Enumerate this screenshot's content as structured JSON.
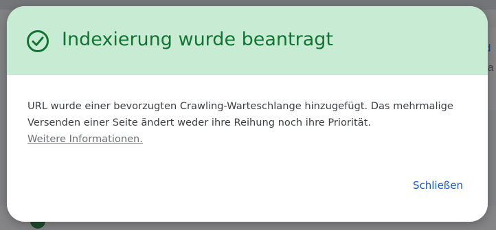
{
  "background": {
    "right_text_1": "d",
    "right_text_2": "a"
  },
  "dialog": {
    "icon": "check-circle-icon",
    "title": "Indexierung wurde beantragt",
    "message": "URL wurde einer bevorzugten Crawling-Warteschlange hinzugefügt. Das mehrmalige Versenden einer Seite ändert weder ihre Reihung noch ihre Priorität.",
    "link_text": "Weitere Informationen.",
    "close_label": "Schließen"
  },
  "colors": {
    "header_bg": "#c8ecd3",
    "title": "#137333",
    "accent_link": "#1a57c8"
  }
}
